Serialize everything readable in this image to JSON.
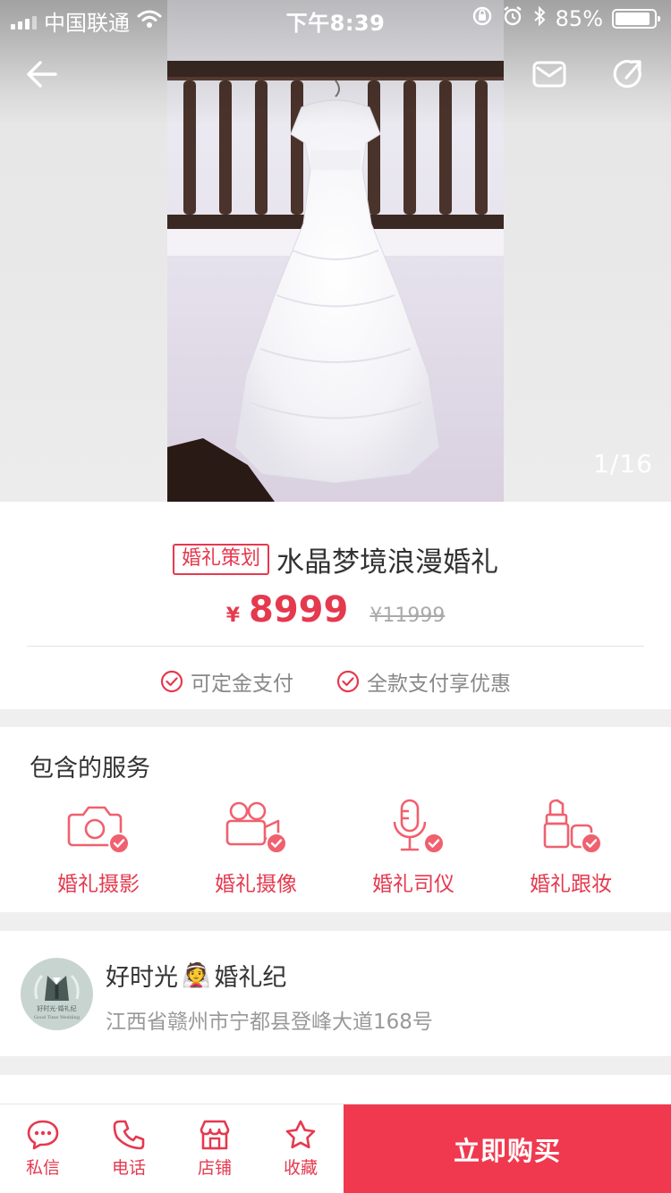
{
  "status_bar": {
    "carrier": "中国联通",
    "time": "下午8:39",
    "battery_percent": "85%",
    "battery_level": 0.85,
    "icons": [
      "signal-icon",
      "wifi-icon",
      "rotation-lock-icon",
      "alarm-icon",
      "bluetooth-icon",
      "battery-icon"
    ]
  },
  "header": {
    "back_icon": "back-arrow-icon",
    "message_icon": "mail-icon",
    "share_icon": "share-icon",
    "page_indicator": "1/16"
  },
  "product": {
    "tag": "婚礼策划",
    "title": "水晶梦境浪漫婚礼",
    "currency": "¥",
    "price": "8999",
    "original_price": "¥11999",
    "payment_options": [
      {
        "label": "可定金支付",
        "icon": "check-circle-icon"
      },
      {
        "label": "全款支付享优惠",
        "icon": "check-circle-icon"
      }
    ]
  },
  "services": {
    "title": "包含的服务",
    "items": [
      {
        "label": "婚礼摄影",
        "icon": "camera-icon"
      },
      {
        "label": "婚礼摄像",
        "icon": "video-camera-icon"
      },
      {
        "label": "婚礼司仪",
        "icon": "microphone-icon"
      },
      {
        "label": "婚礼跟妆",
        "icon": "lipstick-icon"
      }
    ]
  },
  "shop": {
    "name": "好时光",
    "name_suffix": "婚礼纪",
    "emoji": "👰",
    "address": "江西省赣州市宁都县登峰大道168号",
    "logo_text": "好时光·婚礼纪",
    "logo_subtext": "Good Time Wedding"
  },
  "bottom_bar": {
    "items": [
      {
        "label": "私信",
        "icon": "chat-bubble-icon"
      },
      {
        "label": "电话",
        "icon": "phone-icon"
      },
      {
        "label": "店铺",
        "icon": "store-icon"
      },
      {
        "label": "收藏",
        "icon": "star-icon"
      }
    ],
    "buy_label": "立即购买"
  },
  "colors": {
    "accent": "#e5394e",
    "buy_button": "#f0394e",
    "muted_text": "#999999"
  }
}
